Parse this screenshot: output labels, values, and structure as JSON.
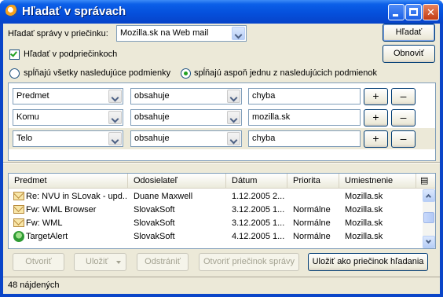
{
  "window": {
    "title": "Hľadať v správach"
  },
  "search": {
    "folder_label": "Hľadať správy v priečinku:",
    "folder_value": "Mozilla.sk na Web mail",
    "search_button": "Hľadať",
    "clear_button": "Obnoviť",
    "subfolders_label": "Hľadať v podpriečinkoch",
    "subfolders_checked": true,
    "match_all_label": "spĺňajú všetky nasledujúce podmienky",
    "match_any_label": "spĺňajú aspoň jednu z nasledujúcich podmienok",
    "match_mode": "any"
  },
  "conditions": [
    {
      "field": "Predmet",
      "operator": "obsahuje",
      "value": "chyba",
      "selected": false
    },
    {
      "field": "Komu",
      "operator": "obsahuje",
      "value": "mozilla.sk",
      "selected": false
    },
    {
      "field": "Telo",
      "operator": "obsahuje",
      "value": "chyba",
      "selected": true
    }
  ],
  "condition_buttons": {
    "add": "+",
    "remove": "–"
  },
  "results": {
    "columns": [
      "Predmet",
      "Odosielateľ",
      "Dátum",
      "Priorita",
      "Umiestnenie"
    ],
    "rows": [
      {
        "icon": "envelope-icon",
        "subject": "Re: NVU in SLovak - upd...",
        "sender": "Duane Maxwell",
        "date": "1.12.2005 2...",
        "priority": "",
        "location": "Mozilla.sk"
      },
      {
        "icon": "envelope-icon",
        "subject": "Fw: WML Browser",
        "sender": "SlovakSoft",
        "date": "3.12.2005 1...",
        "priority": "Normálne",
        "location": "Mozilla.sk"
      },
      {
        "icon": "envelope-icon",
        "subject": "Fw: WML",
        "sender": "SlovakSoft",
        "date": "3.12.2005 1...",
        "priority": "Normálne",
        "location": "Mozilla.sk"
      },
      {
        "icon": "alert-icon",
        "subject": "TargetAlert",
        "sender": "SlovakSoft",
        "date": "4.12.2005 1...",
        "priority": "Normálne",
        "location": "Mozilla.sk"
      }
    ]
  },
  "actions": {
    "open": "Otvoriť",
    "save": "Uložiť",
    "delete": "Odstrániť",
    "open_folder": "Otvoriť priečinok správy",
    "save_as_search_folder": "Uložiť ako priečinok hľadania"
  },
  "status": {
    "text": "48 nájdených"
  },
  "colors": {
    "title_bar": "#0550dc",
    "dialog_bg": "#ece9d8",
    "check_green": "#21a121"
  }
}
